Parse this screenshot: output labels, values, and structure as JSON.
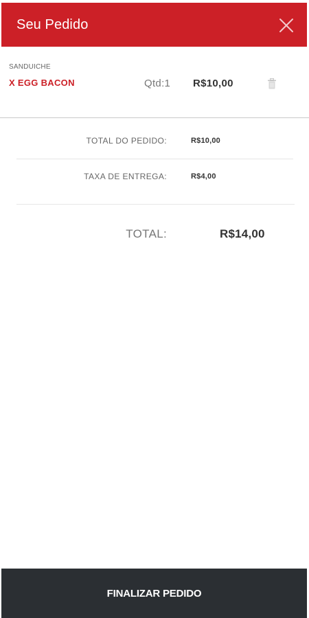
{
  "header": {
    "title": "Seu Pedido",
    "close_icon": "close-icon"
  },
  "cart": {
    "items": [
      {
        "category": "SANDUICHE",
        "name": "X EGG BACON",
        "quantity": "Qtd:1",
        "price": "R$10,00",
        "delete_icon": "trash-icon"
      }
    ]
  },
  "summary": {
    "order_total_label": "TOTAL DO PEDIDO:",
    "order_total_value": "R$10,00",
    "delivery_fee_label": "TAXA DE ENTREGA:",
    "delivery_fee_value": "R$4,00",
    "total_label": "TOTAL:",
    "total_value": "R$14,00"
  },
  "footer": {
    "checkout_label": "FINALIZAR PEDIDO"
  },
  "colors": {
    "brand_red": "#cc2027",
    "footer_dark": "#2b2f33"
  }
}
